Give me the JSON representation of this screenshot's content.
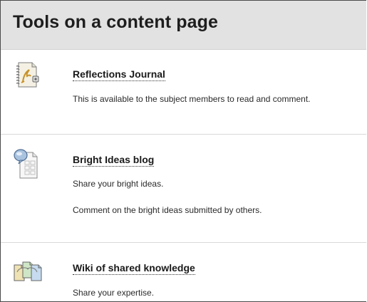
{
  "header": {
    "title": "Tools on a content page"
  },
  "tools": [
    {
      "icon": "journal-icon",
      "title": "Reflections Journal",
      "descriptions": [
        "This is available to the subject members to read and comment."
      ]
    },
    {
      "icon": "blog-icon",
      "title": "Bright Ideas blog",
      "descriptions": [
        "Share your bright ideas.",
        "Comment on the bright ideas submitted by others."
      ]
    },
    {
      "icon": "wiki-icon",
      "title": "Wiki of shared knowledge",
      "descriptions": [
        "Share your expertise."
      ]
    }
  ]
}
